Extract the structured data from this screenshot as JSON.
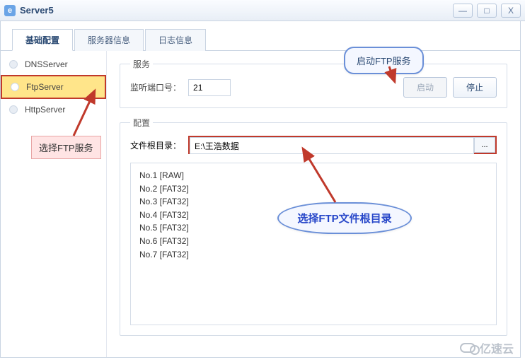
{
  "window": {
    "title": "Server5",
    "min": "—",
    "max": "□",
    "close": "X"
  },
  "tabs": [
    {
      "label": "基础配置",
      "active": true
    },
    {
      "label": "服务器信息",
      "active": false
    },
    {
      "label": "日志信息",
      "active": false
    }
  ],
  "servers": [
    {
      "name": "DNSServer",
      "selected": false
    },
    {
      "name": "FtpServer",
      "selected": true
    },
    {
      "name": "HttpServer",
      "selected": false
    }
  ],
  "service": {
    "legend": "服务",
    "port_label": "监听端口号：",
    "port_value": "21",
    "start_label": "启动",
    "stop_label": "停止"
  },
  "config": {
    "legend": "配置",
    "root_label": "文件根目录：",
    "root_value": "E:\\王浩数据",
    "browse": "...",
    "listing": [
      "No.1 [RAW]",
      "No.2 [FAT32]",
      "No.3 [FAT32]",
      "No.4 [FAT32]",
      "No.5 [FAT32]",
      "No.6 [FAT32]",
      "No.7 [FAT32]"
    ]
  },
  "annotations": {
    "select_ftp": "选择FTP服务",
    "start_ftp": "启动FTP服务",
    "select_root": "选择FTP文件根目录"
  },
  "watermark": "亿速云",
  "colors": {
    "annotation_red": "#c0392b",
    "annotation_blue": "#6a8fd8"
  }
}
